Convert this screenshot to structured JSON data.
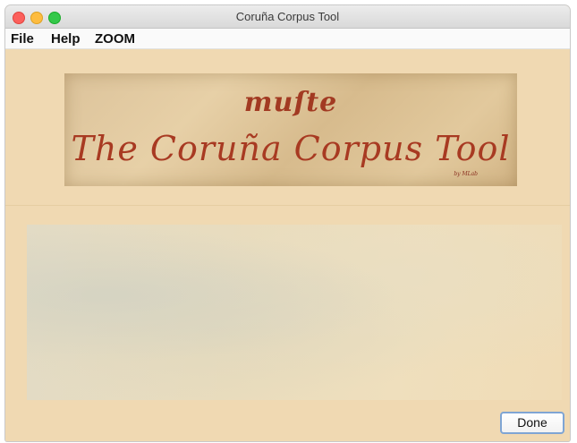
{
  "window": {
    "title": "Coruña Corpus Tool"
  },
  "menu": {
    "file": "File",
    "help": "Help",
    "zoom": "ZOOM"
  },
  "banner": {
    "small_text": "muſte",
    "big_text": "The Coruña Corpus Tool",
    "signature": "by MLab"
  },
  "buttons": {
    "done": "Done"
  },
  "colors": {
    "background": "#f0d9b2",
    "banner_text": "#a83a22",
    "button_focus": "#7fa5d4"
  }
}
